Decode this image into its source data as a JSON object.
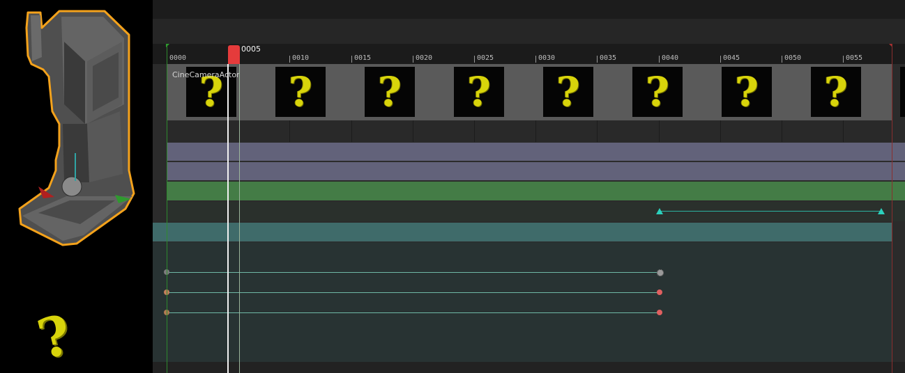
{
  "viewport": {
    "actor_icon": "camera-icon",
    "missing_icon": "question-mark-icon",
    "missing_glyph": "?"
  },
  "sequencer": {
    "playhead_frame": "0005",
    "ruler_ticks": [
      "0000",
      "0010",
      "0015",
      "0020",
      "0025",
      "0030",
      "0035",
      "0040",
      "0045",
      "0050",
      "0055"
    ],
    "track_label": "CineCameraActor",
    "thumbnail_glyph": "?",
    "colors": {
      "playhead": "#e53b3b",
      "thumb_strip": "#5a5a5a",
      "track_purple": "#62627a",
      "track_green": "#447c46",
      "track_teal": "#3f6b6a",
      "key_accent": "#2bb3a0"
    }
  }
}
